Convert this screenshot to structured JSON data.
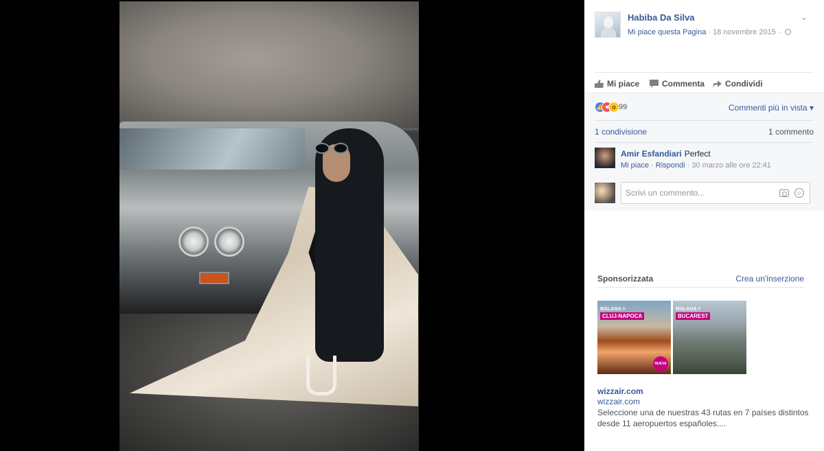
{
  "photo": {
    "alt": ""
  },
  "post": {
    "page_name": "Habiba Da Silva",
    "like_page": "Mi piace questa Pagina",
    "separator": " · ",
    "date": "18 novembre 2015",
    "privacy_separator": " · "
  },
  "actions": {
    "like": "Mi piace",
    "comment": "Commenta",
    "share": "Condividi"
  },
  "reactions": {
    "like_icon": "like-reaction",
    "love_icon": "love-reaction",
    "wow_icon": "wow-reaction",
    "count": "99"
  },
  "sort_label": "Commenti più in vista",
  "sort_arrow": "▾",
  "shares": "1 condivisione",
  "comments_count": "1 commento",
  "comment": {
    "author": "Amir Esfandiari",
    "text": "Perfect",
    "like": "Mi piace",
    "sep1": " · ",
    "reply": "Rispondi",
    "sep2": " · ",
    "time": "30 marzo alle ore 22:41"
  },
  "compose": {
    "placeholder": "Scrivi un commento..."
  },
  "sponsored": {
    "heading": "Sponsorizzata",
    "create": "Crea un'inserzione",
    "ads": [
      {
        "tag": "MÁLAGA >",
        "city": "CLUJ-NAPOCA",
        "badge": "NUEVA RUTA!"
      },
      {
        "tag": "MÁLAGA >",
        "city": "BUCAREST"
      }
    ],
    "title": "wizzair.com",
    "domain": "wizzair.com",
    "description": "Seleccione una de nuestras 43 rutas en 7 países distintos desde 11 aeropuertos españoles...."
  },
  "colors": {
    "link": "#365899",
    "panel_gray": "#f6f7f9",
    "like_blue": "#4080ff",
    "love_red": "#f25268",
    "wow_yellow": "#fcc824",
    "wizz_magenta": "#c6007e"
  }
}
